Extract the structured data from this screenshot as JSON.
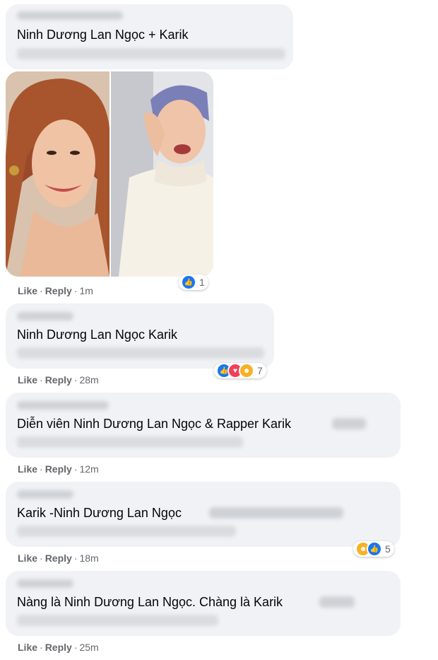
{
  "comments": [
    {
      "text": "Ninh Dương Lan Ngọc + Karik",
      "actions": {
        "like": "Like",
        "reply": "Reply",
        "time": "1m"
      },
      "reactions": {
        "count": "1",
        "icons": [
          "like-icon"
        ]
      },
      "has_photo": true
    },
    {
      "text": "Ninh Dương Lan Ngọc Karik",
      "actions": {
        "like": "Like",
        "reply": "Reply",
        "time": "28m"
      },
      "reactions": {
        "count": "7",
        "icons": [
          "like-icon",
          "love-icon",
          "haha-icon"
        ]
      }
    },
    {
      "text": "Diễn viên Ninh Dương Lan Ngọc & Rapper Karik",
      "actions": {
        "like": "Like",
        "reply": "Reply",
        "time": "12m"
      }
    },
    {
      "text": "Karik -Ninh Dương Lan Ngọc",
      "actions": {
        "like": "Like",
        "reply": "Reply",
        "time": "18m"
      },
      "reactions": {
        "count": "5",
        "icons": [
          "haha-icon",
          "like-icon"
        ]
      }
    },
    {
      "text": "Nàng là Ninh Dương Lan Ngọc. Chàng là Karik",
      "actions": {
        "like": "Like",
        "reply": "Reply",
        "time": "25m"
      }
    }
  ],
  "colors": {
    "bubble": "#f0f2f5",
    "action_text": "#65676b",
    "like": "#1877f2",
    "love": "#f33e58",
    "haha": "#f7b125"
  }
}
